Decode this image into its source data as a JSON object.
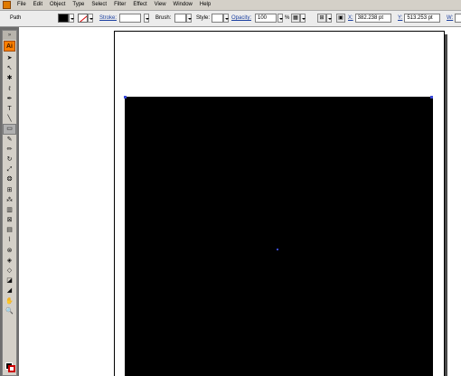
{
  "menubar": {
    "items": [
      "File",
      "Edit",
      "Object",
      "Type",
      "Select",
      "Filter",
      "Effect",
      "View",
      "Window",
      "Help"
    ]
  },
  "controlbar": {
    "selection_label": "Path",
    "stroke_label": "Stroke:",
    "brush_label": "Brush:",
    "style_label": "Style:",
    "opacity_label": "Opacity:",
    "opacity_value": "100",
    "percent_label": "%",
    "x_label": "X:",
    "x_value": "382.238 pt",
    "y_label": "Y:",
    "y_value": "513.253 pt",
    "w_label": "W:"
  },
  "toolbox": {
    "logo": "Ai",
    "grip": "»",
    "tools": [
      {
        "name": "selection-tool",
        "glyph": "➤"
      },
      {
        "name": "direct-selection-tool",
        "glyph": "↖"
      },
      {
        "name": "magic-wand-tool",
        "glyph": "✱"
      },
      {
        "name": "lasso-tool",
        "glyph": "ℓ"
      },
      {
        "name": "pen-tool",
        "glyph": "✒"
      },
      {
        "name": "type-tool",
        "glyph": "T"
      },
      {
        "name": "line-segment-tool",
        "glyph": "╲"
      },
      {
        "name": "rectangle-tool",
        "glyph": "▭"
      },
      {
        "name": "paintbrush-tool",
        "glyph": "✎"
      },
      {
        "name": "pencil-tool",
        "glyph": "✏"
      },
      {
        "name": "rotate-tool",
        "glyph": "↻"
      },
      {
        "name": "scale-tool",
        "glyph": "⤢"
      },
      {
        "name": "warp-tool",
        "glyph": "❂"
      },
      {
        "name": "free-transform-tool",
        "glyph": "⊞"
      },
      {
        "name": "symbol-sprayer-tool",
        "glyph": "⁂"
      },
      {
        "name": "column-graph-tool",
        "glyph": "▥"
      },
      {
        "name": "mesh-tool",
        "glyph": "⊠"
      },
      {
        "name": "gradient-tool",
        "glyph": "▤"
      },
      {
        "name": "eyedropper-tool",
        "glyph": "⌇"
      },
      {
        "name": "blend-tool",
        "glyph": "⊗"
      },
      {
        "name": "live-paint-bucket-tool",
        "glyph": "◈"
      },
      {
        "name": "live-paint-selection-tool",
        "glyph": "◇"
      },
      {
        "name": "slice-tool",
        "glyph": "◪"
      },
      {
        "name": "eraser-tool",
        "glyph": "◢"
      },
      {
        "name": "hand-tool",
        "glyph": "✋"
      },
      {
        "name": "zoom-tool",
        "glyph": "🔍"
      }
    ],
    "active_tool": "rectangle-tool"
  },
  "colors": {
    "fill": "#000000",
    "stroke": "#cc0000",
    "selection": "#3a4ad8"
  }
}
